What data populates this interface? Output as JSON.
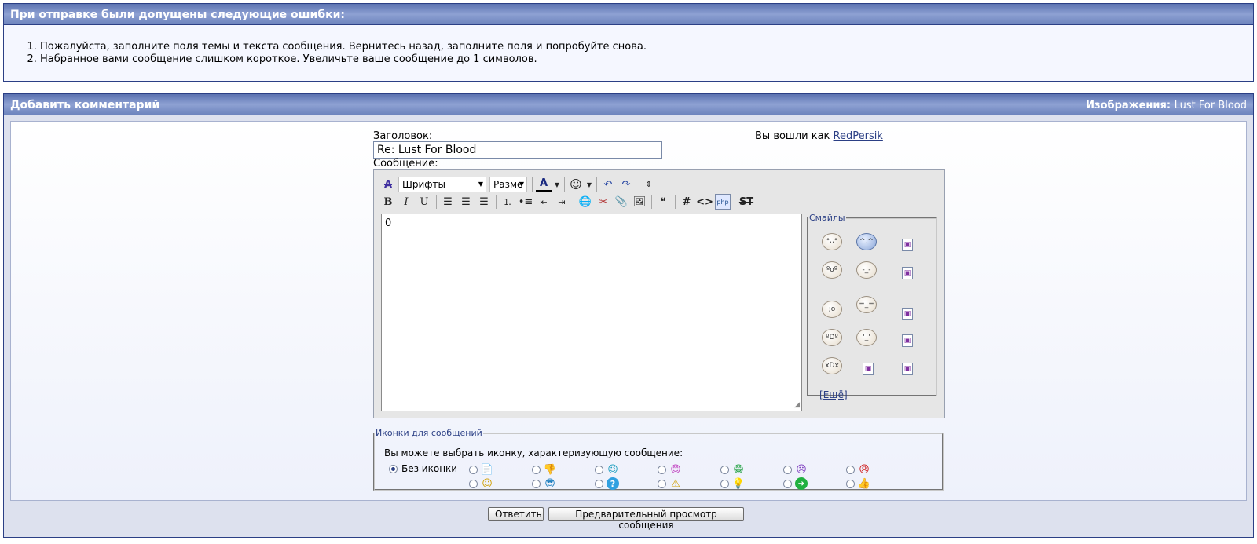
{
  "errors": {
    "title": "При отправке были допущены следующие ошибки:",
    "items": [
      "Пожалуйста, заполните поля темы и текста сообщения. Вернитесь назад, заполните поля и попробуйте снова.",
      "Набранное вами сообщение слишком короткое. Увеличьте ваше сообщение до 1 символов."
    ]
  },
  "comment": {
    "title": "Добавить комментарий",
    "section_label": "Изображения:",
    "section_value": "Lust For Blood"
  },
  "form": {
    "subject_label": "Заголовок:",
    "subject_value": "Re: Lust For Blood",
    "logged_in_prefix": "Вы вошли как",
    "username": "RedPersik",
    "message_label": "Сообщение:",
    "message_value": "0",
    "font_select": "Шрифты",
    "size_select": "Разме"
  },
  "smileys": {
    "legend": "Смайлы",
    "more": "Ещё",
    "more_open": "[",
    "more_close": "]"
  },
  "post_icons": {
    "legend": "Иконки для сообщений",
    "hint": "Вы можете выбрать иконку, характеризующую сообщение:",
    "no_icon_label": "Без иконки",
    "icons_row1": [
      "note-icon",
      "thumbs-down-icon",
      "wink-icon",
      "happy-icon",
      "grin-icon",
      "sad-icon",
      "angry-icon"
    ],
    "icons_row2": [
      "smile-icon",
      "cool-icon",
      "question-icon",
      "warning-icon",
      "lightbulb-icon",
      "arrow-right-icon",
      "thumbs-up-icon"
    ]
  },
  "buttons": {
    "reply": "Ответить",
    "preview": "Предварительный просмотр сообщения"
  },
  "colors": {
    "header_bar": "#6d84bd",
    "border": "#2b3f85",
    "link": "#2b3f85"
  }
}
